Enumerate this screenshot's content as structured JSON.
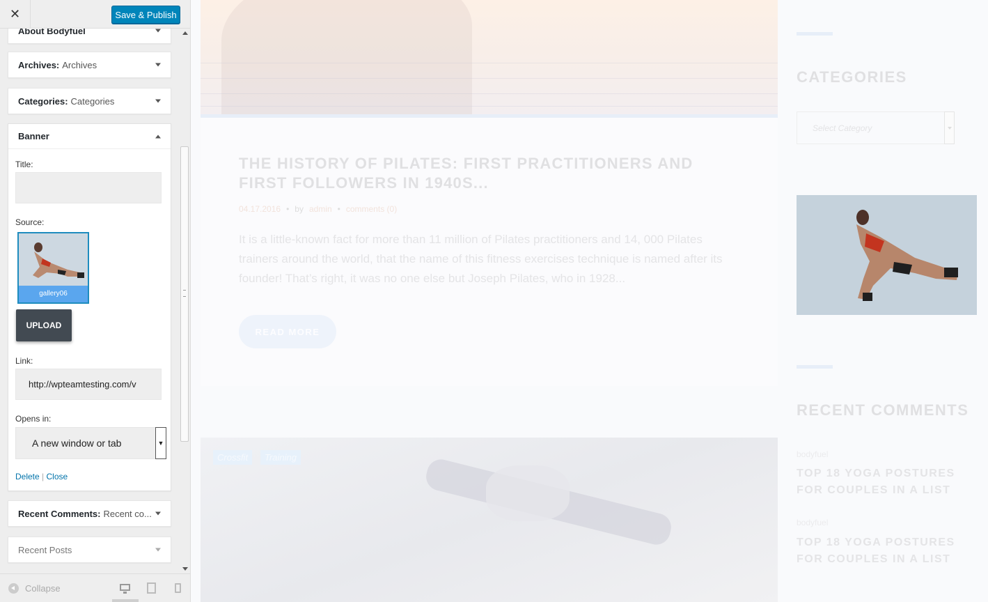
{
  "panel": {
    "close_glyph": "✕",
    "save_label": "Save & Publish",
    "widgets_top": [
      {
        "title": "About Bodyfuel",
        "sub": ""
      },
      {
        "title": "Archives:",
        "sub": "Archives"
      },
      {
        "title": "Categories:",
        "sub": "Categories"
      }
    ],
    "banner": {
      "title": "Banner",
      "title_label": "Title:",
      "title_value": "",
      "source_label": "Source:",
      "image_caption": "gallery06",
      "upload_label": "UPLOAD",
      "link_label": "Link:",
      "link_value": "http://wpteamtesting.com/v",
      "opens_label": "Opens in:",
      "opens_value": "A new window or tab",
      "delete_label": "Delete",
      "separator": "|",
      "close_label": "Close"
    },
    "widgets_bottom": [
      {
        "title": "Recent Comments:",
        "sub": "Recent co..."
      },
      {
        "title": "Recent Posts",
        "sub": ""
      }
    ],
    "footer": {
      "collapse_label": "Collapse",
      "devices": [
        "desktop-icon",
        "tablet-icon",
        "mobile-icon"
      ]
    }
  },
  "preview": {
    "post": {
      "title": "THE HISTORY OF PILATES: FIRST PRACTITIONERS AND FIRST FOLLOWERS IN 1940S...",
      "date": "04.17.2016",
      "by_label": "by",
      "author": "admin",
      "comments": "comments (0)",
      "excerpt": "It is a little-known fact for more than 11 million of Pilates practitioners and 14, 000 Pilates trainers around the world, that the name of this fitness exercises technique is named after its founder! That’s right, it was no one else but Joseph Pilates, who in 1928...",
      "read_more": "READ MORE"
    },
    "tags": [
      "Crossfit",
      "Training"
    ],
    "sidebar": {
      "categories_heading": "CATEGORIES",
      "select_placeholder": "Select Category",
      "recent_comments_heading": "RECENT COMMENTS",
      "comments": [
        {
          "author": "bodyfuel",
          "title": "TOP 18 YOGA POSTURES FOR COUPLES IN A LIST"
        },
        {
          "author": "bodyfuel",
          "title": "TOP 18 YOGA POSTURES FOR COUPLES IN A LIST"
        }
      ]
    }
  },
  "colors": {
    "primary_button": "#0085ba",
    "upload_button": "#424a52",
    "selected_caption": "#5aa6ee",
    "link": "#0073aa"
  }
}
